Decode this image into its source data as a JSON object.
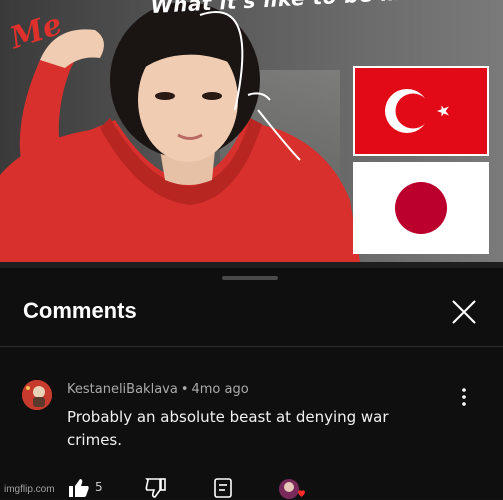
{
  "video": {
    "caption": "What it's like to be mixed?",
    "label": "Me"
  },
  "comments": {
    "title": "Comments",
    "items": [
      {
        "author": "KestaneliBaklava",
        "separator": "•",
        "age": "4mo ago",
        "text": "Probably an absolute beast at denying war crimes.",
        "likes": "5"
      }
    ]
  },
  "watermark": "imgflip.com",
  "colors": {
    "turkey_red": "#e30a17",
    "japan_red": "#bc002d",
    "panel_bg": "#0f0f0f",
    "hoodie": "#d8302c"
  },
  "icons": [
    "close-icon",
    "more-vert-icon",
    "thumbs-up-icon",
    "thumbs-down-icon",
    "reply-icon",
    "creator-heart-icon"
  ]
}
